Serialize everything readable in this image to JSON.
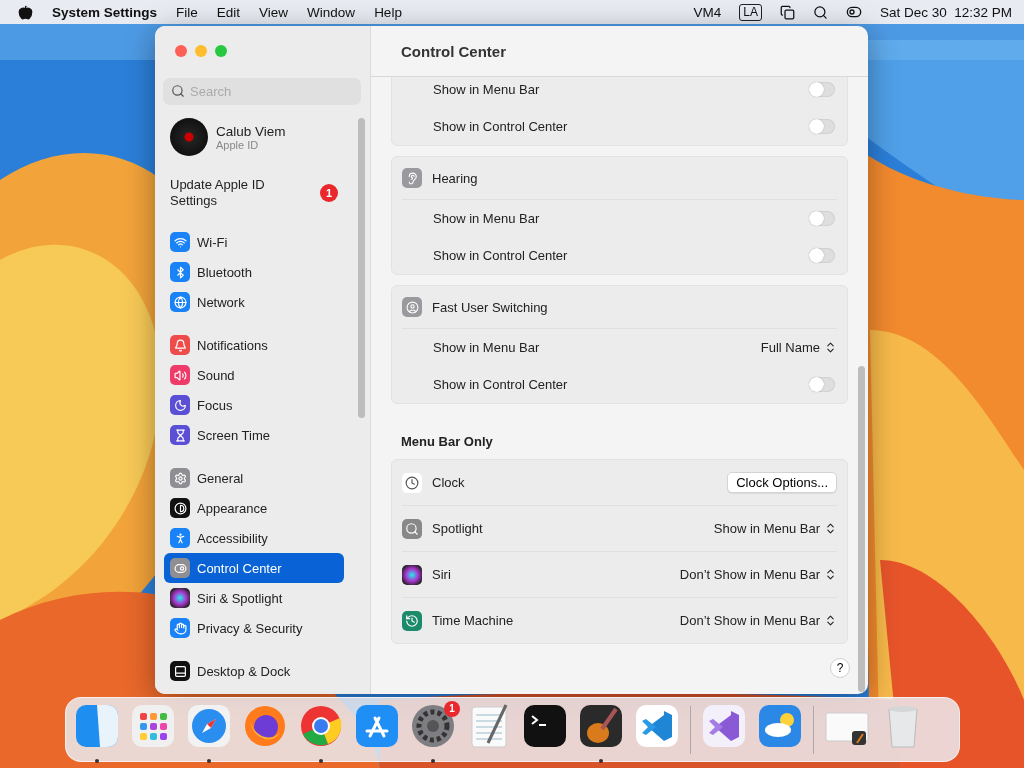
{
  "menu_bar": {
    "app_name": "System Settings",
    "menus": [
      "File",
      "Edit",
      "View",
      "Window",
      "Help"
    ],
    "status_label": "VM4",
    "input_source": "LA",
    "datetime": "Sat Dec 30  12:32 PM"
  },
  "window": {
    "title": "Control Center",
    "help": "?"
  },
  "sidebar": {
    "search": {
      "placeholder": "Search"
    },
    "account": {
      "name": "Calub Viem",
      "subtitle": "Apple ID"
    },
    "update": {
      "label": "Update Apple ID Settings",
      "badge": "1"
    },
    "groups": [
      {
        "items": [
          {
            "label": "Wi-Fi",
            "selected": false
          },
          {
            "label": "Bluetooth",
            "selected": false
          },
          {
            "label": "Network",
            "selected": false
          }
        ]
      },
      {
        "items": [
          {
            "label": "Notifications",
            "selected": false
          },
          {
            "label": "Sound",
            "selected": false
          },
          {
            "label": "Focus",
            "selected": false
          },
          {
            "label": "Screen Time",
            "selected": false
          }
        ]
      },
      {
        "items": [
          {
            "label": "General",
            "selected": false
          },
          {
            "label": "Appearance",
            "selected": false
          },
          {
            "label": "Accessibility",
            "selected": false
          },
          {
            "label": "Control Center",
            "selected": true
          },
          {
            "label": "Siri & Spotlight",
            "selected": false
          },
          {
            "label": "Privacy & Security",
            "selected": false
          }
        ]
      },
      {
        "items": [
          {
            "label": "Desktop & Dock",
            "selected": false
          }
        ]
      }
    ]
  },
  "content": {
    "modules": [
      {
        "rows": [
          {
            "label": "Show in Menu Bar",
            "kind": "toggle",
            "on": false
          },
          {
            "label": "Show in Control Center",
            "kind": "toggle",
            "on": false
          }
        ]
      },
      {
        "title": "Hearing",
        "rows": [
          {
            "label": "Show in Menu Bar",
            "kind": "toggle",
            "on": false
          },
          {
            "label": "Show in Control Center",
            "kind": "toggle",
            "on": false
          }
        ]
      },
      {
        "title": "Fast User Switching",
        "rows": [
          {
            "label": "Show in Menu Bar",
            "kind": "select",
            "value": "Full Name"
          },
          {
            "label": "Show in Control Center",
            "kind": "toggle",
            "on": false
          }
        ]
      }
    ],
    "menu_bar_only": {
      "heading": "Menu Bar Only",
      "rows": [
        {
          "label": "Clock",
          "kind": "button",
          "value": "Clock Options..."
        },
        {
          "label": "Spotlight",
          "kind": "select",
          "value": "Show in Menu Bar"
        },
        {
          "label": "Siri",
          "kind": "select",
          "value": "Don’t Show in Menu Bar"
        },
        {
          "label": "Time Machine",
          "kind": "select",
          "value": "Don’t Show in Menu Bar"
        }
      ]
    }
  },
  "dock": {
    "sections": [
      {
        "items": [
          {
            "running": true
          },
          {
            "running": false
          },
          {
            "running": true
          },
          {
            "running": false
          },
          {
            "running": true
          },
          {
            "running": false
          },
          {
            "running": true,
            "badge": "1"
          },
          {
            "running": false
          },
          {
            "running": false
          },
          {
            "running": true
          },
          {
            "running": false
          }
        ]
      },
      {
        "items": [
          {
            "running": false
          },
          {
            "running": false
          }
        ]
      },
      {
        "items": [
          {
            "running": false
          },
          {
            "running": false
          }
        ]
      }
    ]
  }
}
